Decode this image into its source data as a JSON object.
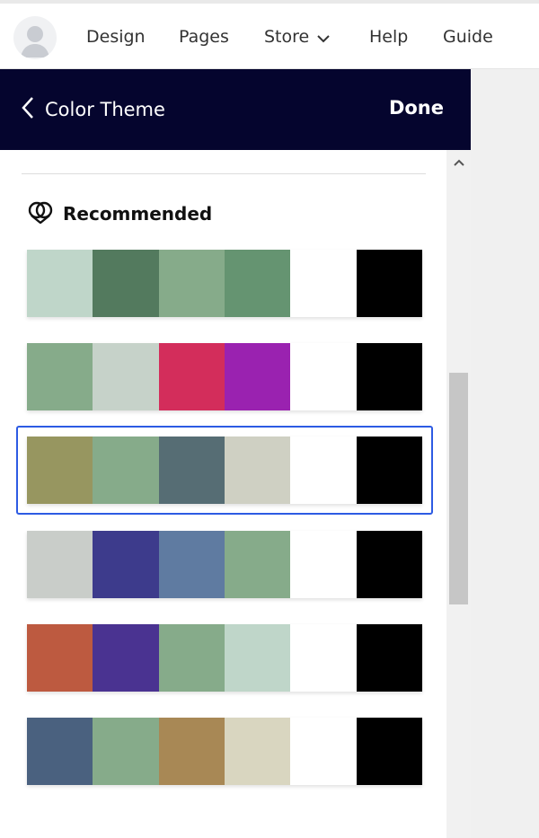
{
  "topnav": {
    "items": [
      {
        "label": "Design"
      },
      {
        "label": "Pages"
      },
      {
        "label": "Store"
      },
      {
        "label": "Help"
      },
      {
        "label": "Guide"
      }
    ]
  },
  "panel": {
    "back_label": "Color Theme",
    "done_label": "Done",
    "section_title": "Recommended"
  },
  "palettes": [
    {
      "colors": [
        "#bfd6c9",
        "#537a5e",
        "#86ab8a",
        "#659471",
        "#ffffff",
        "#000000"
      ],
      "selected": false
    },
    {
      "colors": [
        "#86ab8a",
        "#c6d2c9",
        "#d32d5b",
        "#9a22b0",
        "#ffffff",
        "#000000"
      ],
      "selected": false
    },
    {
      "colors": [
        "#979660",
        "#86ab8a",
        "#566d74",
        "#cfd0c3",
        "#ffffff",
        "#000000"
      ],
      "selected": true
    },
    {
      "colors": [
        "#c9cdc9",
        "#3d3b8c",
        "#5f7ba1",
        "#86ab8a",
        "#ffffff",
        "#000000"
      ],
      "selected": false
    },
    {
      "colors": [
        "#bd5a40",
        "#4a3391",
        "#86ab8a",
        "#bfd6c9",
        "#ffffff",
        "#000000"
      ],
      "selected": false
    },
    {
      "colors": [
        "#4a617f",
        "#86ab8a",
        "#a88855",
        "#d9d6c0",
        "#ffffff",
        "#000000"
      ],
      "selected": false
    }
  ],
  "colors": {
    "header_bg": "#05052e",
    "selection_border": "#2d5be3"
  }
}
